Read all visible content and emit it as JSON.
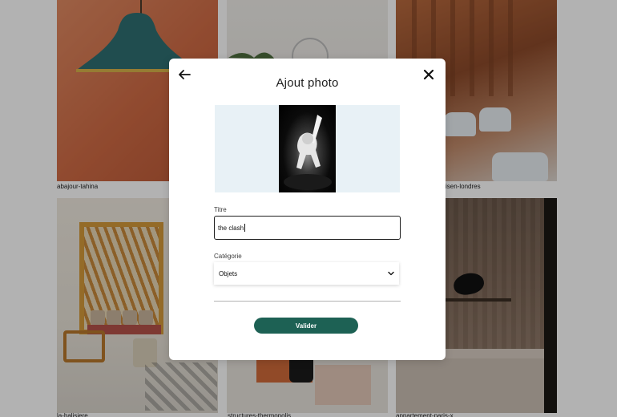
{
  "gallery": {
    "captions": [
      "abajour-tahina",
      "isen-londres",
      "la-balisiere",
      "structures-thermopolis",
      "appartement-paris-x"
    ]
  },
  "modal": {
    "title": "Ajout photo",
    "back_icon": "arrow-left-icon",
    "close_icon": "close-icon",
    "title_field": {
      "label": "Titre",
      "value": "the clash"
    },
    "category_field": {
      "label": "Catégorie",
      "selected": "Objets"
    },
    "submit_label": "Valider"
  },
  "colors": {
    "submit_bg": "#1d6154",
    "preview_bg": "#e8f1f6",
    "overlay": "rgba(0,0,0,0.30)"
  }
}
